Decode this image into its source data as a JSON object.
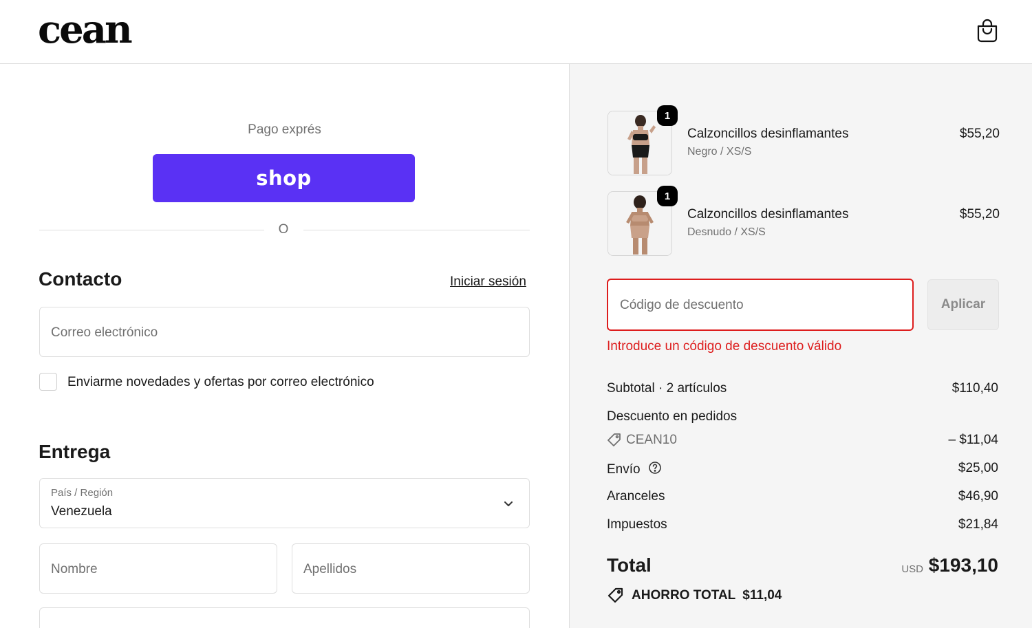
{
  "header": {
    "logo": "cean",
    "cart_icon": "shopping-bag-icon"
  },
  "express": {
    "label": "Pago exprés",
    "shop_button": "shop",
    "divider": "O"
  },
  "contact": {
    "title": "Contacto",
    "login_link": "Iniciar sesión",
    "email_placeholder": "Correo electrónico",
    "newsletter_label": "Enviarme novedades y ofertas por correo electrónico"
  },
  "delivery": {
    "title": "Entrega",
    "country_label": "País / Región",
    "country_value": "Venezuela",
    "first_name_placeholder": "Nombre",
    "last_name_placeholder": "Apellidos"
  },
  "products": [
    {
      "name": "Calzoncillos desinflamantes",
      "variant": "Negro / XS/S",
      "price": "$55,20",
      "quantity": "1",
      "color": "#1a1a1a"
    },
    {
      "name": "Calzoncillos desinflamantes",
      "variant": "Desnudo / XS/S",
      "price": "$55,20",
      "quantity": "1",
      "color": "#c9a189"
    }
  ],
  "discount": {
    "placeholder": "Código de descuento",
    "apply_button": "Aplicar",
    "error": "Introduce un código de descuento válido"
  },
  "summary": {
    "subtotal_label": "Subtotal · 2 artículos",
    "subtotal_value": "$110,40",
    "order_discount_label": "Descuento en pedidos",
    "discount_code": "CEAN10",
    "discount_value": "– $11,04",
    "shipping_label": "Envío",
    "shipping_value": "$25,00",
    "duties_label": "Aranceles",
    "duties_value": "$46,90",
    "taxes_label": "Impuestos",
    "taxes_value": "$21,84",
    "total_label": "Total",
    "currency": "USD",
    "total_value": "$193,10",
    "savings_label": "AHORRO TOTAL",
    "savings_value": "$11,04"
  },
  "colors": {
    "shop_purple": "#5a31f4",
    "error_red": "#dd1d1d",
    "summary_bg": "#f5f5f5"
  }
}
